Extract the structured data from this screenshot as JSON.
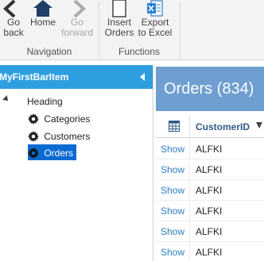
{
  "ribbon": {
    "navigation": {
      "label": "Navigation",
      "back": "Go\nback",
      "home": "Home",
      "forward": "Go\nforward"
    },
    "functions": {
      "label": "Functions",
      "insert": "Insert\nOrders",
      "export": "Export\nto Excel"
    }
  },
  "nav": {
    "title": "MyFirstBarItem",
    "heading": "Heading",
    "items": [
      {
        "label": "Categories"
      },
      {
        "label": "Customers"
      },
      {
        "label": "Orders"
      }
    ]
  },
  "main": {
    "title": "Orders (834)",
    "columns": {
      "customer_id": "CustomerID"
    },
    "rows": [
      {
        "action": "Show",
        "customer_id": "ALFKI"
      },
      {
        "action": "Show",
        "customer_id": "ALFKI"
      },
      {
        "action": "Show",
        "customer_id": "ALFKI"
      },
      {
        "action": "Show",
        "customer_id": "ALFKI"
      },
      {
        "action": "Show",
        "customer_id": "ALFKI"
      },
      {
        "action": "Show",
        "customer_id": "ALFKI"
      }
    ]
  },
  "colors": {
    "nav_bar": "#2d9fe0",
    "header_bar": "#6f9fd0",
    "selected": "#0a6ad1",
    "link": "#2d7fc1"
  }
}
